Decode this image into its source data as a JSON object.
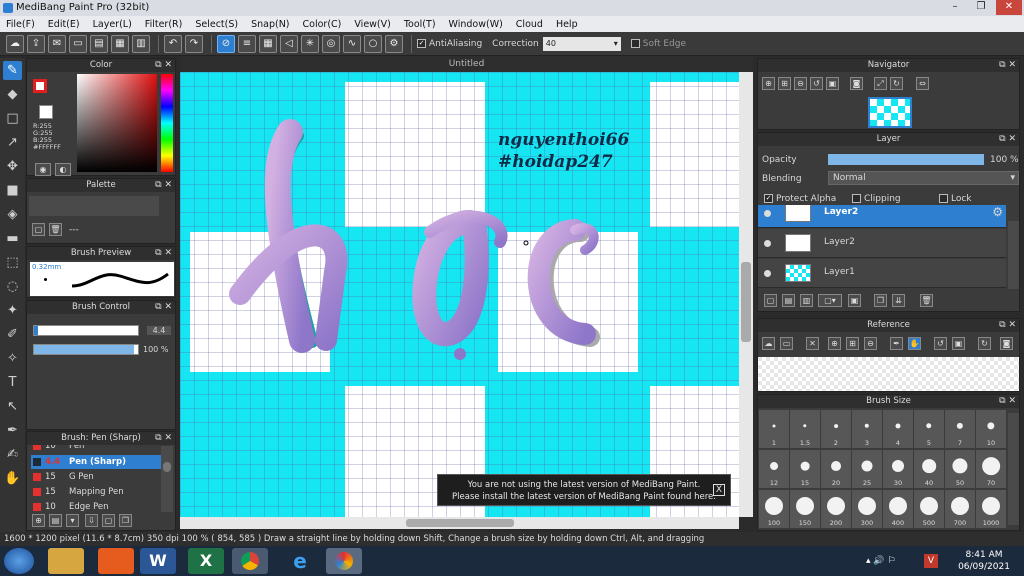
{
  "window": {
    "title": "MediBang Paint Pro (32bit)"
  },
  "menu": [
    "File(F)",
    "Edit(E)",
    "Layer(L)",
    "Filter(R)",
    "Select(S)",
    "Snap(N)",
    "Color(C)",
    "View(V)",
    "Tool(T)",
    "Window(W)",
    "Cloud",
    "Help"
  ],
  "toolbar": {
    "antialiasing_label": "AntiAliasing",
    "correction_label": "Correction",
    "correction_value": "40",
    "soft_edge_label": "Soft Edge"
  },
  "color_panel": {
    "title": "Color",
    "r": "R:255",
    "g": "G:255",
    "b": "B:255",
    "hex": "#FFFFFF",
    "primary_color": "#e02020"
  },
  "palette_panel": {
    "title": "Palette",
    "hint": "---"
  },
  "brush_preview": {
    "title": "Brush Preview",
    "size": "0.32mm"
  },
  "brush_control": {
    "title": "Brush Control",
    "size_value": "4.4",
    "opacity_value": "100 %",
    "size_level": 0.95,
    "opacity_level": 0.96
  },
  "brush_list": {
    "title": "Brush: Pen (Sharp)",
    "items": [
      {
        "size": "10",
        "name": "Pen",
        "color": "#e53030"
      },
      {
        "size": "4.4",
        "name": "Pen (Sharp)",
        "color": "#2e7fd0",
        "selected": true
      },
      {
        "size": "15",
        "name": "G Pen",
        "color": "#e53030"
      },
      {
        "size": "15",
        "name": "Mapping Pen",
        "color": "#e53030"
      },
      {
        "size": "10",
        "name": "Edge Pen",
        "color": "#e53030"
      }
    ]
  },
  "canvas": {
    "tab": "Untitled",
    "watermark_line1": "nguyenthoi66",
    "watermark_line2": "#hoidap247",
    "artwork_text": "học"
  },
  "notice": {
    "line1": "You are not using the latest version of MediBang Paint.",
    "line2": "Please install the latest version of MediBang Paint found here.",
    "close": "X"
  },
  "navigator": {
    "title": "Navigator"
  },
  "layer_panel": {
    "title": "Layer",
    "opacity_label": "Opacity",
    "opacity_value": "100 %",
    "opacity_level": 1.0,
    "blending_label": "Blending",
    "blending_value": "Normal",
    "protect_alpha": "Protect Alpha",
    "clipping": "Clipping",
    "lock": "Lock",
    "layers": [
      {
        "name": "Layer2",
        "selected": true
      },
      {
        "name": "Layer2",
        "selected": false
      },
      {
        "name": "Layer1",
        "selected": false
      }
    ]
  },
  "reference": {
    "title": "Reference"
  },
  "brush_size": {
    "title": "Brush Size",
    "sizes": [
      "1",
      "1.5",
      "2",
      "3",
      "4",
      "5",
      "7",
      "10",
      "12",
      "15",
      "20",
      "25",
      "30",
      "40",
      "50",
      "70",
      "100",
      "150",
      "200",
      "300",
      "400",
      "500",
      "700",
      "1000"
    ]
  },
  "status": {
    "text": "1600 * 1200 pixel  (11.6 * 8.7cm)  350 dpi  100 %  ( 854, 585 )  Draw a straight line by holding down Shift, Change a brush size by holding down Ctrl, Alt, and dragging"
  },
  "taskbar": {
    "time": "8:41 AM",
    "date": "06/09/2021"
  },
  "colors": {
    "accent": "#2e7fd0",
    "canvas_cyan": "#16e5f2",
    "letter_pink": "#c9a2dc",
    "letter_purple": "#8e76c9",
    "letter_teal": "#15a3a3"
  }
}
